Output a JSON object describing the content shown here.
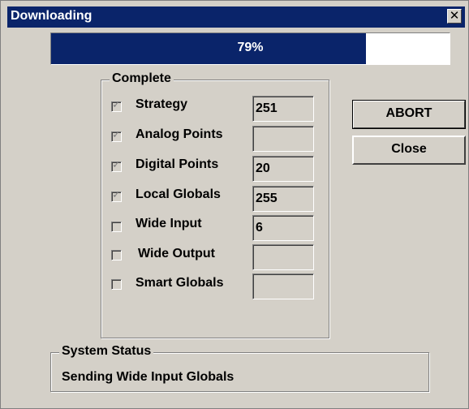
{
  "window": {
    "title": "Downloading",
    "close_glyph": "✕"
  },
  "progress": {
    "value": 0.79,
    "label": "79%"
  },
  "complete": {
    "label": "Complete",
    "items": [
      {
        "label": "Strategy",
        "checked": true,
        "value": "251"
      },
      {
        "label": "Analog Points",
        "checked": true,
        "value": ""
      },
      {
        "label": "Digital Points",
        "checked": true,
        "value": "20"
      },
      {
        "label": "Local Globals",
        "checked": true,
        "value": "255"
      },
      {
        "label": "Wide Input",
        "checked": false,
        "value": "6"
      },
      {
        "label": "Wide Output",
        "checked": false,
        "value": ""
      },
      {
        "label": "Smart Globals",
        "checked": false,
        "value": ""
      }
    ]
  },
  "buttons": {
    "abort": "ABORT",
    "close": "Close"
  },
  "system_status": {
    "label": "System Status",
    "text": "Sending Wide Input Globals"
  },
  "colors": {
    "titlebar": "#0a246a",
    "face": "#d4d0c8",
    "progress_fill": "#0a246a"
  }
}
